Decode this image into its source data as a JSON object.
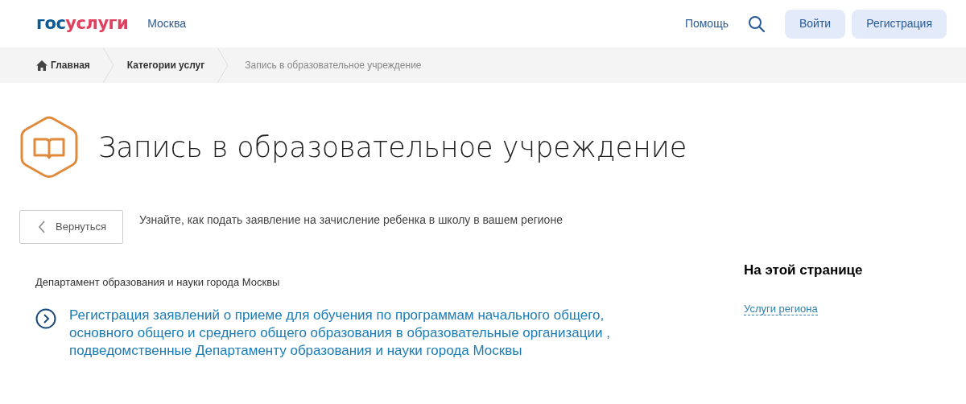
{
  "header": {
    "logo": [
      {
        "text": "гос",
        "color": "#0b5a94"
      },
      {
        "text": "услуги",
        "color": "#e0405e"
      }
    ],
    "region": "Москва",
    "help": "Помощь",
    "buttons": [
      "Войти",
      "Регистрация"
    ]
  },
  "breadcrumbs": [
    {
      "label": "Главная",
      "current": false,
      "home": true
    },
    {
      "label": "Категории услуг",
      "current": false,
      "home": false
    },
    {
      "label": "Запись в образовательное учреждение",
      "current": true,
      "home": false
    }
  ],
  "title": "Запись в образовательное учреждение",
  "back_button": "Вернуться",
  "intro": "Узнайте, как подать заявление на зачисление ребенка в школу в вашем регионе",
  "department": "Департамент образования и науки города Москвы",
  "services": [
    "Регистрация заявлений о приеме для обучения по программам начального общего, основного общего и среднего общего образования в образовательные организации , подведомственные Департаменту образования и науки города Москвы"
  ],
  "sidebar": {
    "heading": "На этой странице",
    "links": [
      "Услуги региона"
    ]
  }
}
